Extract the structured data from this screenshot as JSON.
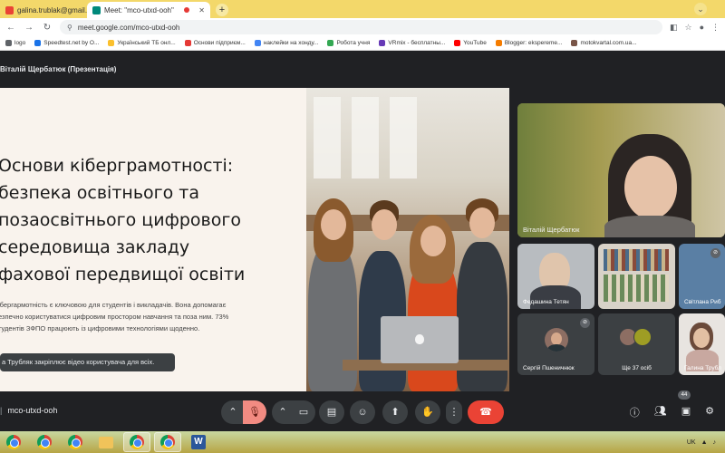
{
  "browser": {
    "tabs": [
      {
        "label": "galina.trublak@gmail.co",
        "active": false
      },
      {
        "label": "Meet: \"mco-utxd-ooh\"",
        "active": true
      }
    ],
    "new_tab": "+",
    "url": "meet.google.com/mco-utxd-ooh",
    "bookmarks": [
      "logo",
      "Speedtest.net by O...",
      "Український ТБ онл...",
      "Основи підприєм...",
      "наклейки на хонду...",
      "Робота учня",
      "VRmix - бесплатны...",
      "YouTube",
      "Blogger: ekspereme...",
      "motokvartal.com.ua..."
    ]
  },
  "meet": {
    "presenter_label": "Віталій Щербатюк (Презентація)",
    "slide": {
      "title": "Основи кіберграмотності:\nбезпека освітнього та\nпозаосвітнього цифрового\nсередовища закладу\nфахової передвищої освіти",
      "body": "ібергармотність є ключовою для студентів і викладачів. Вона допомагає\nезпечно користуватися цифровим простором навчання та поза ним. 73%\nтудентів ЗФПО працюють із цифровими технологіями щоденно."
    },
    "toast": "а Трубляк закріплює відео користувача для всіх.",
    "participants": {
      "main": "Віталій Щербатюк",
      "tiles": [
        {
          "name": "Федашина Тетян"
        },
        {
          "name": ""
        },
        {
          "name": "Світлана Риб"
        },
        {
          "name": "Сергій Пшеничнюк"
        },
        {
          "name": "Ще 37 осіб"
        },
        {
          "name": "Галина Трубл"
        }
      ]
    },
    "meeting_code": "mco-utxd-ooh",
    "people_count": "44",
    "colors": {
      "hangup": "#ea4335",
      "mic_off": "#f28b82",
      "bar": "#202124"
    }
  },
  "taskbar": {
    "tray": "UK"
  }
}
